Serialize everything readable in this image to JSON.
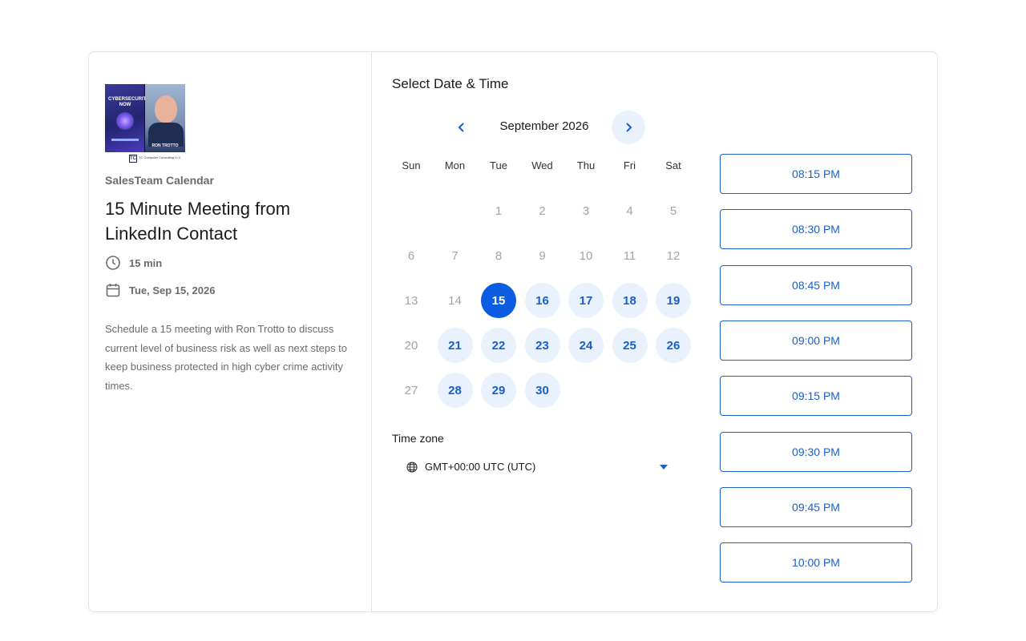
{
  "event": {
    "org_name": "SalesTeam Calendar",
    "title": "15 Minute Meeting from LinkedIn Contact",
    "duration": "15 min",
    "date": "Tue, Sep 15, 2026",
    "description": "Schedule a 15 meeting with Ron Trotto to discuss current level of business risk as well as next steps to keep business protected in high cyber crime activity times.",
    "logo": {
      "book_title": "CYBERSECURITY NOW",
      "person_name": "RON TROTTO",
      "company": "TC Computer Consulting LLC",
      "mark": "TC"
    }
  },
  "picker": {
    "heading": "Select Date & Time",
    "month_label": "September 2026",
    "weekdays": [
      "Sun",
      "Mon",
      "Tue",
      "Wed",
      "Thu",
      "Fri",
      "Sat"
    ],
    "first_weekday_index": 2,
    "days_in_month": 30,
    "available_days": [
      15,
      16,
      17,
      18,
      19,
      21,
      22,
      23,
      24,
      25,
      26,
      28,
      29,
      30
    ],
    "selected_day": 15
  },
  "timezone": {
    "label": "Time zone",
    "value": "GMT+00:00 UTC (UTC)"
  },
  "time_slots": [
    "08:15 PM",
    "08:30 PM",
    "08:45 PM",
    "09:00 PM",
    "09:15 PM",
    "09:30 PM",
    "09:45 PM",
    "10:00 PM"
  ],
  "colors": {
    "accent": "#0b5ce0",
    "accent_text": "#1a5fc9",
    "available_bg": "#e9f1fd",
    "muted_text": "#6b6b6b",
    "border": "#e3e3e3"
  },
  "icons": {
    "prev": "chevron-left-icon",
    "next": "chevron-right-icon",
    "duration": "clock-icon",
    "date": "calendar-icon",
    "timezone": "globe-icon",
    "dropdown": "caret-down-icon"
  }
}
